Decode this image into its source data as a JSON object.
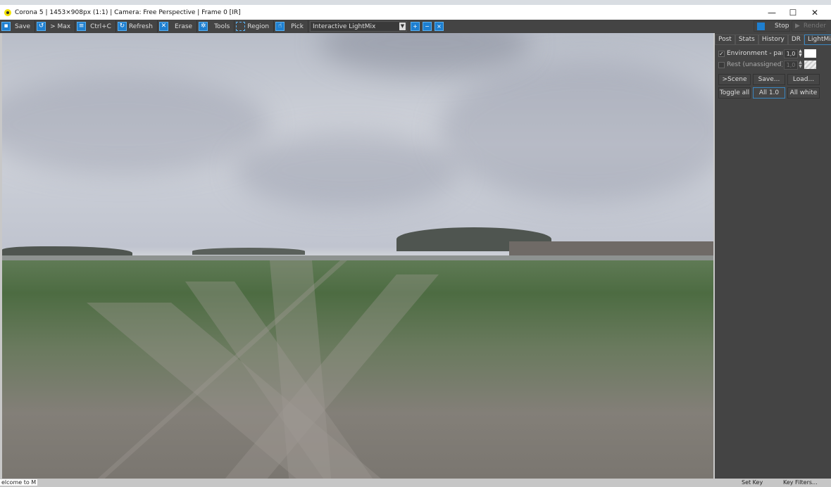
{
  "window": {
    "title": "Corona 5 | 1453×908px (1:1) | Camera: Free Perspective | Frame 0 [IR]",
    "minimize": "—",
    "maximize": "☐",
    "close": "✕"
  },
  "toolbar": {
    "save": "Save",
    "max": "> Max",
    "copy": "Ctrl+C",
    "refresh": "Refresh",
    "erase": "Erase",
    "tools": "Tools",
    "region": "Region",
    "pick": "Pick",
    "mode_select": "Interactive LightMix"
  },
  "render_controls": {
    "stop": "Stop",
    "render": "Render"
  },
  "panel": {
    "tabs": [
      "Post",
      "Stats",
      "History",
      "DR",
      "LightMix"
    ],
    "active_tab": "LightMix",
    "lights": [
      {
        "name": "Environment - panorama",
        "value": "1,0",
        "checked": true,
        "color": "#ffffff"
      },
      {
        "name": "Rest (unassigned):",
        "value": "1,0",
        "checked": false,
        "color": "#e8e8e8"
      }
    ],
    "buttons_row1": [
      ">Scene",
      "Save...",
      "Load..."
    ],
    "buttons_row2": [
      "Toggle all",
      "All 1.0",
      "All white"
    ]
  },
  "bottom": {
    "welcome": "elcome to M",
    "set_key": "Set Key",
    "key_filters": "Key Filters..."
  },
  "colors": {
    "accent": "#1e7fd0",
    "panel_bg": "#444444"
  }
}
